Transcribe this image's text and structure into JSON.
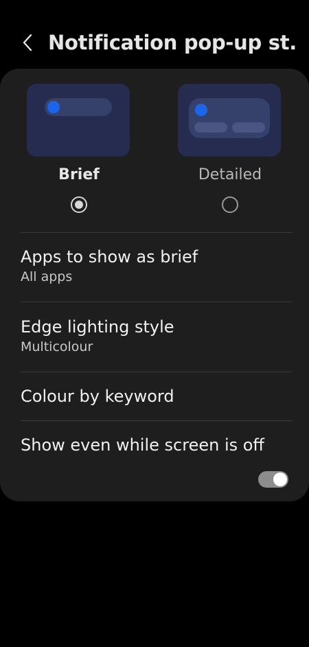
{
  "header": {
    "title": "Notification pop-up st...",
    "back_icon": "chevron-left-icon"
  },
  "style_options": {
    "brief": {
      "label": "Brief",
      "selected": true
    },
    "detailed": {
      "label": "Detailed",
      "selected": false
    }
  },
  "settings": {
    "apps_to_show": {
      "title": "Apps to show as brief",
      "value": "All apps"
    },
    "edge_lighting": {
      "title": "Edge lighting style",
      "value": "Multicolour"
    },
    "colour_by_keyword": {
      "title": "Colour by keyword"
    },
    "show_screen_off": {
      "title": "Show even while screen is off",
      "enabled": true
    }
  },
  "colors": {
    "background": "#000000",
    "card": "#1e1e1e",
    "accent_dot": "#1b66e8",
    "preview_bg": "#262c4f"
  }
}
